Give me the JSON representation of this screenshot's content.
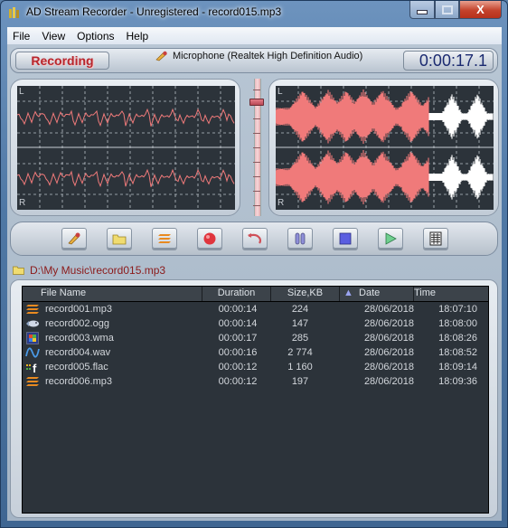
{
  "window": {
    "title": "AD Stream Recorder - Unregistered - record015.mp3",
    "minimize_label": "",
    "maximize_label": "",
    "close_label": "X"
  },
  "menu": {
    "items": [
      {
        "label": "File"
      },
      {
        "label": "View"
      },
      {
        "label": "Options"
      },
      {
        "label": "Help"
      }
    ]
  },
  "status": {
    "state_label": "Recording",
    "source": "Microphone  (Realtek High Definition Audio)",
    "timer": "0:00:17.1"
  },
  "scopes": {
    "left_channel_label": "L",
    "right_channel_label": "R"
  },
  "volume": {
    "level_fraction": 0.85
  },
  "toolbar": {
    "buttons": [
      {
        "name": "source-button",
        "icon": "microphone-icon"
      },
      {
        "name": "open-folder-button",
        "icon": "folder-icon"
      },
      {
        "name": "format-button",
        "icon": "mp3-icon"
      },
      {
        "name": "record-button",
        "icon": "record-icon"
      },
      {
        "name": "undo-button",
        "icon": "undo-icon"
      },
      {
        "name": "pause-button",
        "icon": "pause-icon"
      },
      {
        "name": "stop-button",
        "icon": "stop-icon"
      },
      {
        "name": "play-button",
        "icon": "play-icon"
      },
      {
        "name": "list-button",
        "icon": "list-icon"
      }
    ]
  },
  "output_path": "D:\\My Music\\record015.mp3",
  "files": {
    "columns": {
      "name": "File Name",
      "duration": "Duration",
      "size": "Size,KB",
      "sort_indicator": "▲",
      "date": "Date",
      "time": "Time"
    },
    "rows": [
      {
        "icon": "mp3-icon",
        "name": "record001.mp3",
        "duration": "00:00:14",
        "size": "224",
        "date": "28/06/2018",
        "time": "18:07:10"
      },
      {
        "icon": "ogg-icon",
        "name": "record002.ogg",
        "duration": "00:00:14",
        "size": "147",
        "date": "28/06/2018",
        "time": "18:08:00"
      },
      {
        "icon": "wma-icon",
        "name": "record003.wma",
        "duration": "00:00:17",
        "size": "285",
        "date": "28/06/2018",
        "time": "18:08:26"
      },
      {
        "icon": "wav-icon",
        "name": "record004.wav",
        "duration": "00:00:16",
        "size": "2 774",
        "date": "28/06/2018",
        "time": "18:08:52"
      },
      {
        "icon": "flac-icon",
        "name": "record005.flac",
        "duration": "00:00:12",
        "size": "1 160",
        "date": "28/06/2018",
        "time": "18:09:14"
      },
      {
        "icon": "mp3-icon",
        "name": "record006.mp3",
        "duration": "00:00:12",
        "size": "197",
        "date": "28/06/2018",
        "time": "18:09:36"
      }
    ]
  },
  "colors": {
    "recording_red": "#b8262d",
    "wave_pink": "#f07a7a",
    "wave_white": "#ffffff",
    "scope_bg": "#2c333a",
    "timer_blue": "#1b2a70",
    "path_red": "#8b1a1a"
  }
}
